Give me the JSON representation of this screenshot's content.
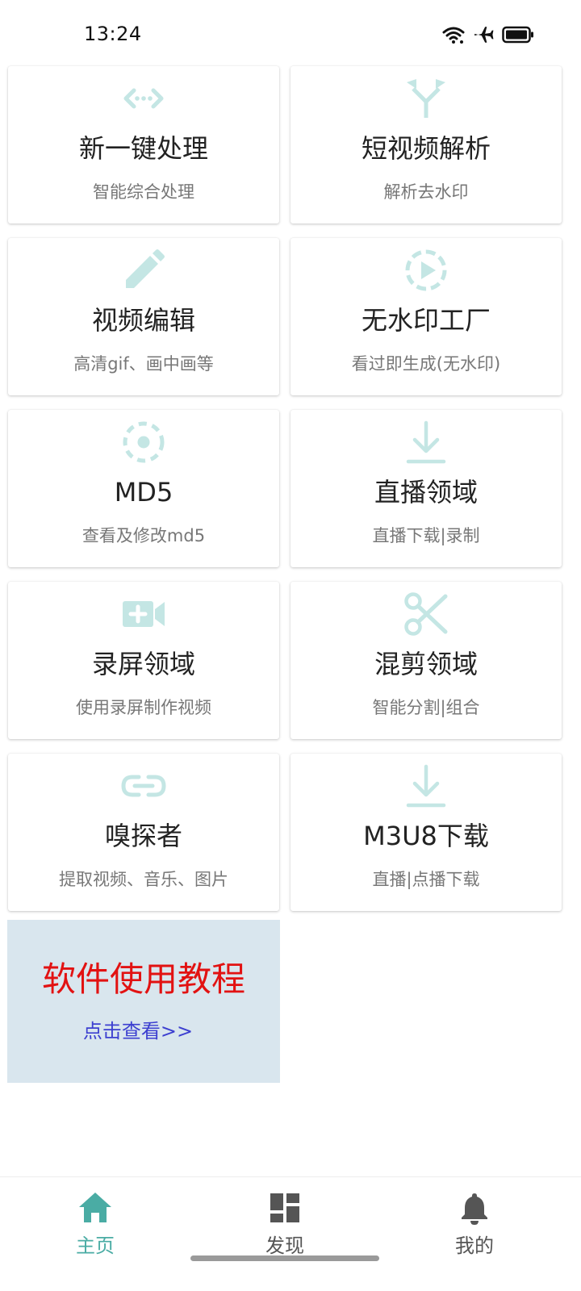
{
  "status_bar": {
    "time": "13:24",
    "icons": [
      "wifi-icon",
      "airplane-icon",
      "battery-icon"
    ]
  },
  "colors": {
    "icon_tint": "#c4e6e4",
    "accent": "#4aaca4",
    "nav_inactive": "#555555",
    "tutorial_bg": "#d9e6ee",
    "tutorial_title": "#e21212",
    "tutorial_link": "#3c3fd0"
  },
  "cards": [
    {
      "title": "新一键处理",
      "subtitle": "智能综合处理",
      "icon": "code-arrows-icon"
    },
    {
      "title": "短视频解析",
      "subtitle": "解析去水印",
      "icon": "merge-arrows-icon"
    },
    {
      "title": "视频编辑",
      "subtitle": "高清gif、画中画等",
      "icon": "pencil-icon"
    },
    {
      "title": "无水印工厂",
      "subtitle": "看过即生成(无水印)",
      "icon": "play-circle-dashed-icon"
    },
    {
      "title": "MD5",
      "subtitle": "查看及修改md5",
      "icon": "dashed-circle-dot-icon"
    },
    {
      "title": "直播领域",
      "subtitle": "直播下载|录制",
      "icon": "download-icon"
    },
    {
      "title": "录屏领域",
      "subtitle": "使用录屏制作视频",
      "icon": "video-add-icon"
    },
    {
      "title": "混剪领域",
      "subtitle": "智能分割|组合",
      "icon": "scissors-icon"
    },
    {
      "title": "嗅探者",
      "subtitle": "提取视频、音乐、图片",
      "icon": "link-icon"
    },
    {
      "title": "M3U8下载",
      "subtitle": "直播|点播下载",
      "icon": "download-icon"
    }
  ],
  "tutorial": {
    "title": "软件使用教程",
    "link": "点击查看>>"
  },
  "bottom_nav": {
    "items": [
      {
        "label": "主页",
        "icon": "home-icon",
        "active": true
      },
      {
        "label": "发现",
        "icon": "dashboard-icon",
        "active": false
      },
      {
        "label": "我的",
        "icon": "bell-icon",
        "active": false
      }
    ]
  }
}
